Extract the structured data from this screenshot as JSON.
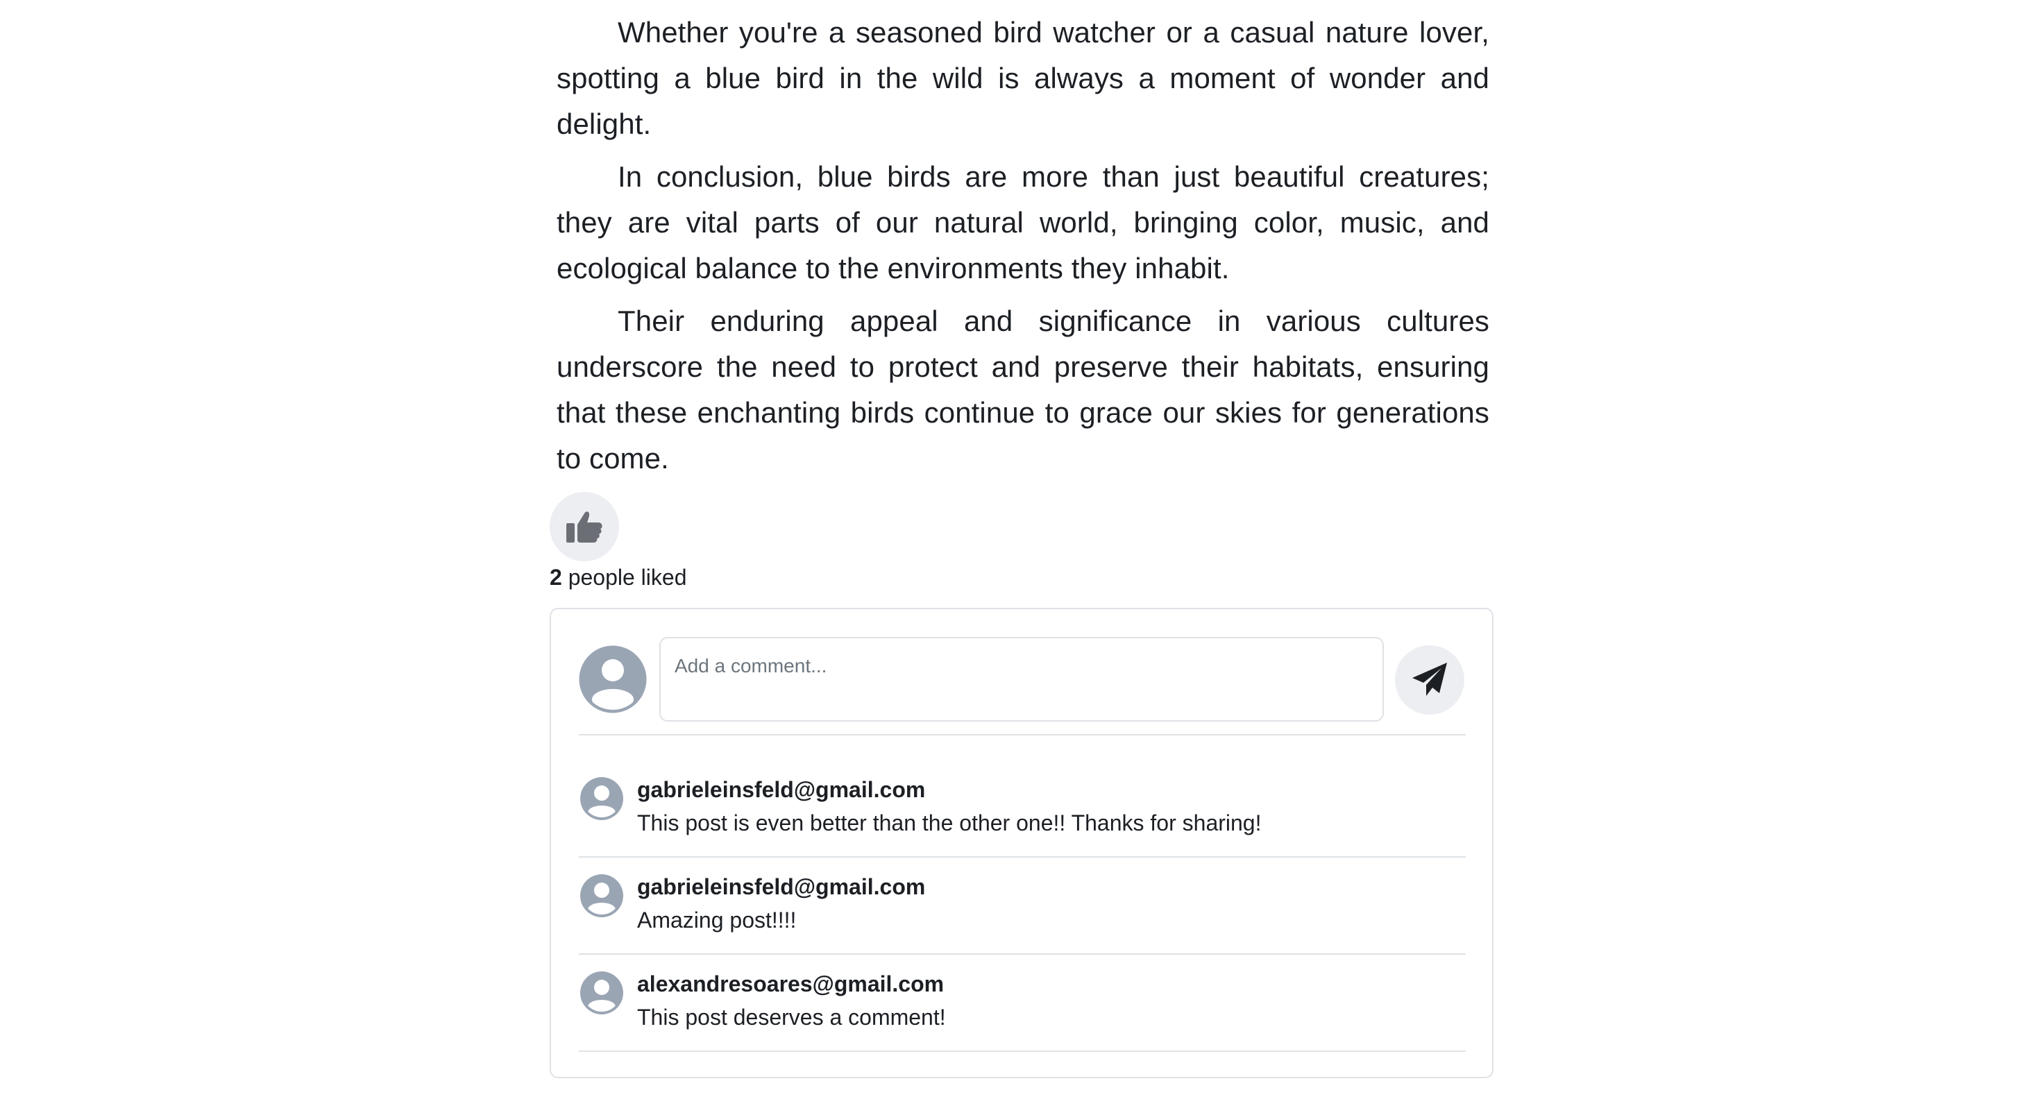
{
  "article": {
    "paragraphs": [
      "Whether you're a seasoned bird watcher or a casual nature lover, spotting a blue bird in the wild is always a moment of wonder and delight.",
      "In conclusion, blue birds are more than just beautiful creatures; they are vital parts of our natural world, bringing color, music, and ecological balance to the environments they inhabit.",
      "Their enduring appeal and significance in various cultures underscore the need to protect and preserve their habitats, ensuring that these enchanting birds continue to grace our skies for generations to come."
    ]
  },
  "likes": {
    "icon": "thumbs-up-icon",
    "count": "2",
    "label": " people liked"
  },
  "comment_form": {
    "avatar_icon": "user-avatar-icon",
    "placeholder": "Add a comment...",
    "value": "",
    "send_icon": "paper-plane-icon"
  },
  "comments": [
    {
      "author": "gabrieleinsfeld@gmail.com",
      "body": "This post is even better than the other one!! Thanks for sharing!"
    },
    {
      "author": "gabrieleinsfeld@gmail.com",
      "body": "Amazing post!!!!"
    },
    {
      "author": "alexandresoares@gmail.com",
      "body": "This post deserves a comment!"
    }
  ],
  "colors": {
    "avatar": "#9aa5b4",
    "button_bg": "#eceef1",
    "like_icon": "#6b6f75",
    "send_icon": "#1c1f24",
    "border": "#dee2e6",
    "text": "#1c1f24"
  }
}
